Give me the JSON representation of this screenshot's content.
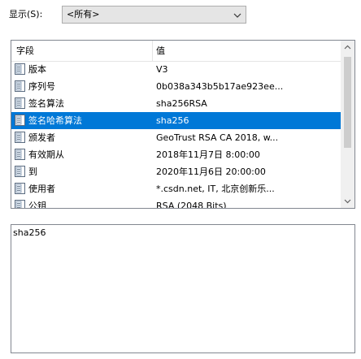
{
  "toolbar": {
    "show_label": "显示(S):",
    "show_value": "<所有>"
  },
  "list": {
    "columns": {
      "field": "字段",
      "value": "值"
    },
    "rows": [
      {
        "field": "版本",
        "value": "V3"
      },
      {
        "field": "序列号",
        "value": "0b038a343b5b17ae923ee..."
      },
      {
        "field": "签名算法",
        "value": "sha256RSA"
      },
      {
        "field": "签名哈希算法",
        "value": "sha256"
      },
      {
        "field": "颁发者",
        "value": "GeoTrust RSA CA 2018, w..."
      },
      {
        "field": "有效期从",
        "value": "2018年11月7日 8:00:00"
      },
      {
        "field": "到",
        "value": "2020年11月6日 20:00:00"
      },
      {
        "field": "使用者",
        "value": "*.csdn.net, IT, 北京创新乐..."
      },
      {
        "field": "公钥",
        "value": "RSA (2048 Bits)"
      }
    ],
    "selected_index": 3
  },
  "detail": {
    "text": "sha256"
  },
  "colors": {
    "selection": "#0078d7",
    "border": "#828790",
    "combo_bg": "#e5e5e5"
  },
  "icons": {
    "row_icon": "certificate-field-icon"
  }
}
